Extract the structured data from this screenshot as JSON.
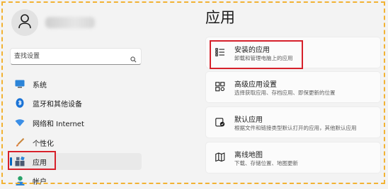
{
  "page": {
    "title": "应用"
  },
  "sidebar": {
    "account_name": "",
    "search": {
      "placeholder": "查找设置"
    },
    "items": [
      {
        "label": "系统",
        "icon": "monitor-icon"
      },
      {
        "label": "蓝牙和其他设备",
        "icon": "bluetooth-icon"
      },
      {
        "label": "网络和 Internet",
        "icon": "wifi-icon"
      },
      {
        "label": "个性化",
        "icon": "brush-icon"
      },
      {
        "label": "应用",
        "icon": "apps-icon",
        "active": true
      },
      {
        "label": "帐户",
        "icon": "person-icon"
      }
    ]
  },
  "main": {
    "cards": [
      {
        "title": "安装的应用",
        "desc": "卸载和管理电脑上的应用",
        "icon": "installed-apps-icon"
      },
      {
        "title": "高级应用设置",
        "desc": "选择获取应用、存档应用、即保更新的位置",
        "icon": "advanced-app-settings-icon"
      },
      {
        "title": "默认应用",
        "desc": "根据文件和链接类型默认打开的应用，其他默认应用",
        "icon": "default-apps-icon"
      },
      {
        "title": "离线地图",
        "desc": "下载、存储位置、地图更新",
        "icon": "offline-maps-icon"
      }
    ]
  },
  "colors": {
    "accent": "#0067c0",
    "highlight": "#d6202a",
    "frame": "#f2b233",
    "background": "#f3f3f3"
  }
}
